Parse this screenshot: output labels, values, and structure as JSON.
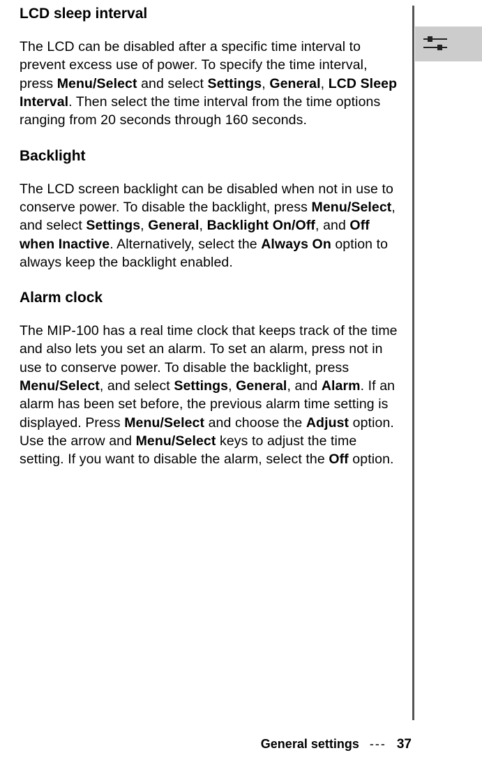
{
  "sections": {
    "lcd": {
      "heading": "LCD sleep interval",
      "p_pre1": "The LCD can be disabled after a specific time interval to prevent excess use of power. To specify the time interval, press ",
      "b1": "Menu/Select",
      "t1": " and select ",
      "b2": "Settings",
      "t2": ", ",
      "b3": "General",
      "t3": ", ",
      "b4": "LCD Sleep Interval",
      "t4": ". Then select the time interval from the time options ranging from 20 seconds through 160 seconds."
    },
    "backlight": {
      "heading": "Backlight",
      "p_pre1": "The LCD screen backlight can be disabled when not in use to conserve power. To disable the backlight, press ",
      "b1": "Menu/Select",
      "t1": ", and select ",
      "b2": "Settings",
      "t2": ", ",
      "b3": "General",
      "t3": ", ",
      "b4": "Backlight On/Off",
      "t4": ", and ",
      "b5": "Off when Inactive",
      "t5": ". Alternatively, select the ",
      "b6": "Always On",
      "t6": " option to always keep the backlight enabled."
    },
    "alarm": {
      "heading": "Alarm clock",
      "p_pre1": "The MIP-100 has a real time clock that keeps track of the time and also lets you set an alarm. To set an alarm, press not in use to conserve power. To disable the backlight, press ",
      "b1": "Menu/Select",
      "t1": ", and select ",
      "b2": "Settings",
      "t2": ", ",
      "b3": "General",
      "t3": ", and ",
      "b4": "Alarm",
      "t4": ". If an alarm has been set before, the previous alarm time setting is displayed. Press ",
      "b5": "Menu/Select",
      "t5": " and choose the ",
      "b6": "Adjust",
      "t6": " option. Use the arrow and ",
      "b7": "Menu/Select",
      "t7": " keys to adjust the time setting. If you want to disable the alarm, select the ",
      "b8": "Off",
      "t8": " option."
    }
  },
  "footer": {
    "section": "General settings",
    "separator": "---",
    "page": "37"
  }
}
